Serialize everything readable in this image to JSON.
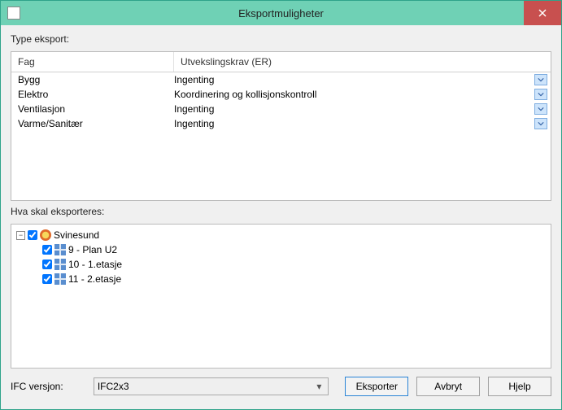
{
  "window": {
    "title": "Eksportmuligheter"
  },
  "typeExport": {
    "label": "Type eksport:",
    "headers": {
      "fag": "Fag",
      "er": "Utvekslingskrav (ER)"
    },
    "rows": [
      {
        "fag": "Bygg",
        "er": "Ingenting"
      },
      {
        "fag": "Elektro",
        "er": "Koordinering og kollisjonskontroll"
      },
      {
        "fag": "Ventilasjon",
        "er": "Ingenting"
      },
      {
        "fag": "Varme/Sanitær",
        "er": "Ingenting"
      }
    ]
  },
  "exportWhat": {
    "label": "Hva skal eksporteres:",
    "root": {
      "name": "Svinesund",
      "checked": true,
      "expanded": true,
      "children": [
        {
          "name": "9 - Plan U2",
          "checked": true
        },
        {
          "name": "10 - 1.etasje",
          "checked": true
        },
        {
          "name": "11 - 2.etasje",
          "checked": true
        }
      ]
    }
  },
  "version": {
    "label": "IFC versjon:",
    "selected": "IFC2x3"
  },
  "buttons": {
    "export": "Eksporter",
    "cancel": "Avbryt",
    "help": "Hjelp"
  }
}
